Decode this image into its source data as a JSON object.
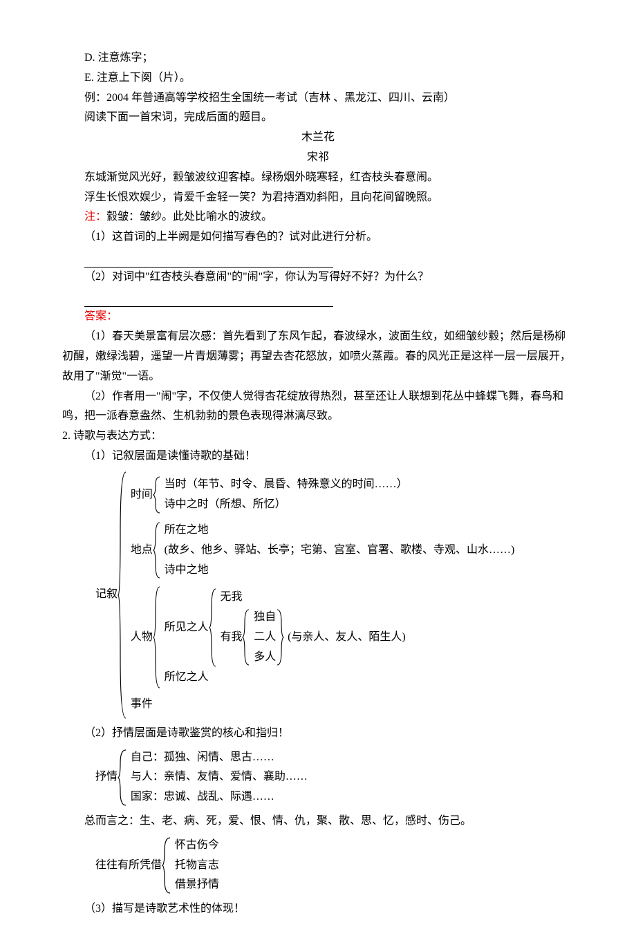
{
  "line_d": "D. 注意炼字；",
  "line_e": "E. 注意上下阕（片）。",
  "example_intro": "例：2004 年普通高等学校招生全国统一考试（吉林 、黑龙江、四川、云南）",
  "read_prompt": "阅读下面一首宋词，完成后面的题目。",
  "poem_title": "木兰花",
  "poem_author": "宋祁",
  "poem_l1": "东城渐觉风光好，縠皱波纹迎客棹。绿杨烟外晓寒轻，红杏枝头春意闹。",
  "poem_l2": "浮生长恨欢娱少，肯爱千金轻一笑？为君持酒劝斜阳，且向花间留晚照。",
  "note_label": "注：",
  "note_body": "縠皱：皱纱。此处比喻水的波纹。",
  "q1": "（1）这首词的上半阙是如何描写春色的？试对此进行分析。",
  "q2": "（2）对词中\"红杏枝头春意闹\"的\"闹\"字，你认为写得好不好？为什么？",
  "answer_label": "答案：",
  "a1": "（1）春天美景富有层次感：首先看到了东风乍起，春波绿水，波面生纹，如细皱纱縠；然后是杨柳初醒，嫩绿浅碧，遥望一片青烟薄雾；再望去杏花怒放，如喷火蒸霞。春的风光正是这样一层一层展开，故用了\"渐觉\"一语。",
  "a2": "（2）作者用一\"闹\"字，不仅使人觉得杏花绽放得热烈，甚至还让人联想到花丛中蜂蝶飞舞，春鸟和鸣，把一派春意盎然、生机勃勃的景色表现得淋漓尽致。",
  "section2": "2. 诗歌与表达方式：",
  "s2_1": "（1）记叙层面是读懂诗歌的基础！",
  "diagram1": {
    "root": "记叙",
    "time": {
      "label": "时间",
      "a": "当时（年节、时令、晨昏、特殊意义的时间……）",
      "b": "诗中之时（所想、所忆）"
    },
    "place": {
      "label": "地点",
      "a": "所在之地",
      "b": "(故乡、他乡、驿站、长亭；宅第、宫室、官署、歌楼、寺观、山水……)",
      "c": "诗中之地"
    },
    "person": {
      "label": "人物",
      "seen": "所见之人",
      "wuwo": "无我",
      "youwo": "有我",
      "alone": "独自",
      "two": "二人",
      "many": "多人",
      "tail": "(与亲人、友人、陌生人)",
      "mem": "所忆之人"
    },
    "event": "事件"
  },
  "s2_2": "（2）抒情层面是诗歌鉴赏的核心和指归！",
  "diagram2": {
    "root": "抒情",
    "a": "自己：孤独、闲情、思古……",
    "b": "与人：亲情、友情、爱情、襄助……",
    "c": "国家：忠诚、战乱、际遇……"
  },
  "summary": "总而言之：生、老、病、死，爱、恨、情、仇，聚、散、思、忆，感时、伤己。",
  "diagram3": {
    "root": "往往有所凭借",
    "a": "怀古伤今",
    "b": "托物言志",
    "c": "借景抒情"
  },
  "s2_3": "（3）描写是诗歌艺术性的体现！"
}
